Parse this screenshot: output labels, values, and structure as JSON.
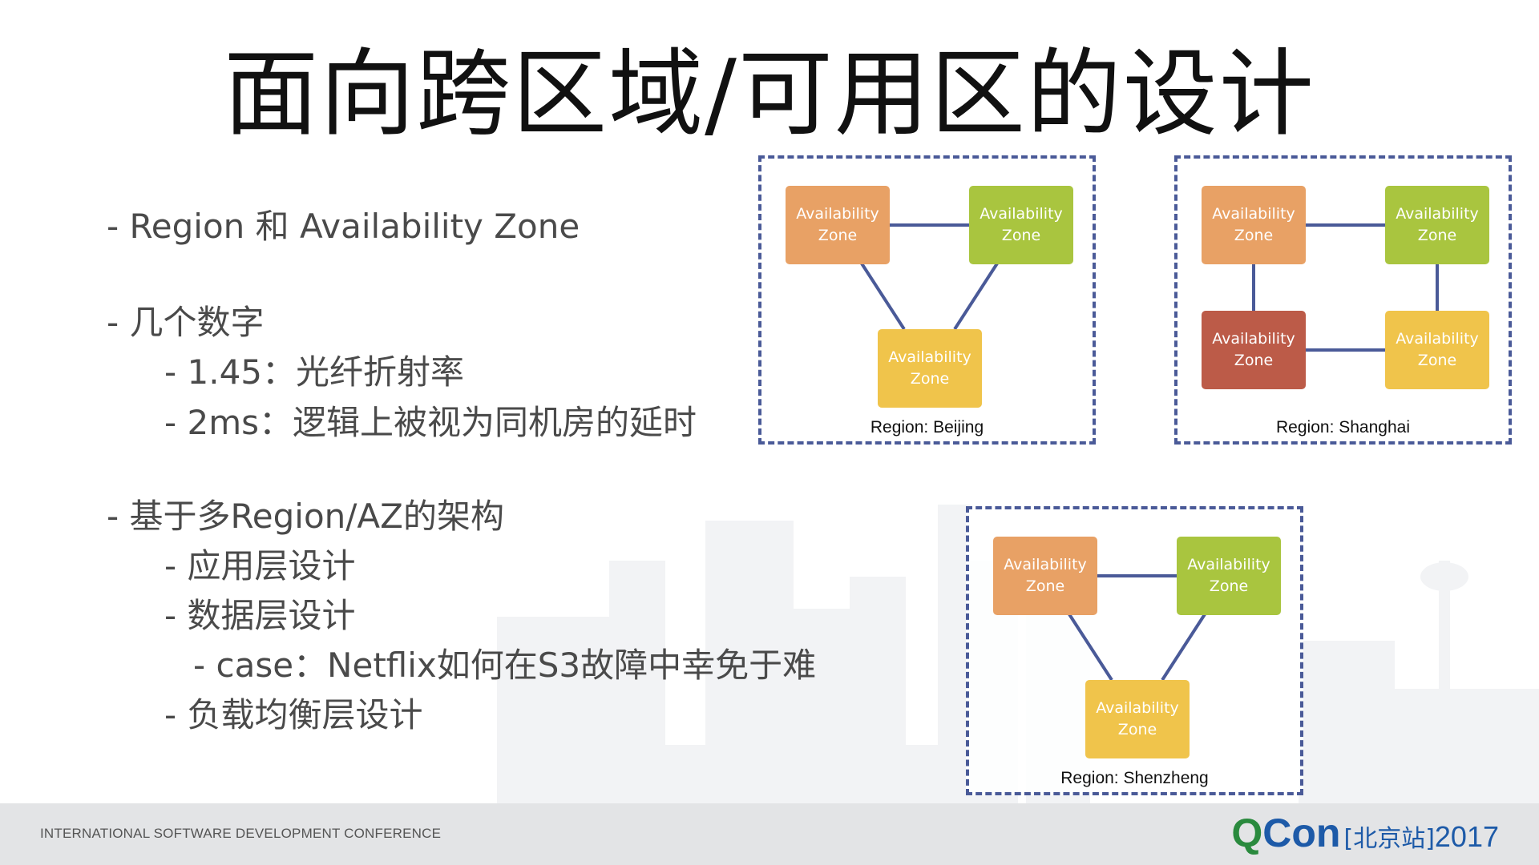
{
  "slide": {
    "title": "面向跨区域/可用区的设计",
    "bullets": [
      "- Region 和 Availability Zone",
      "- 几个数字",
      "- 1.45：光纤折射率",
      "- 2ms：逻辑上被视为同机房的延时",
      "- 基于多Region/AZ的架构",
      "- 应用层设计",
      "- 数据层设计",
      "- case：Netflix如何在S3故障中幸免于难",
      "- 负载均衡层设计"
    ]
  },
  "zone_label": {
    "line1": "Availability",
    "line2": "Zone"
  },
  "regions": [
    {
      "label": "Region: Beijing"
    },
    {
      "label": "Region: Shanghai"
    },
    {
      "label": "Region: Shenzheng"
    }
  ],
  "colors": {
    "orange": "#e8a165",
    "green": "#a9c53f",
    "yellow": "#f0c44b",
    "red": "#bc5b48",
    "link": "#4a5a98",
    "border": "#4a5a98"
  },
  "footer": {
    "conference": "INTERNATIONAL SOFTWARE DEVELOPMENT CONFERENCE",
    "logo_q": "Q",
    "logo_con": "Con",
    "logo_city": "[北京站]",
    "logo_year": "2017"
  }
}
